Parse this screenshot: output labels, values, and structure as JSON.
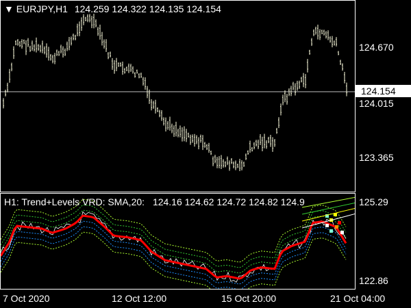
{
  "main": {
    "title_arrow": "▼",
    "title": "EURJPY,H1",
    "ohlc": "124.259 124.322 124.135 124.154",
    "current_price": "124.154",
    "y_labels": [
      "124.670",
      "124.015",
      "123.365"
    ]
  },
  "indicator": {
    "title": "H1: Trend+Levels VRD: SMA,20:",
    "values": "124.16 124.62 124.72 124.82 124.9",
    "y_labels": [
      "125.29",
      "122.86"
    ]
  },
  "x_labels": [
    "7 Oct 2020",
    "12 Oct 12:00",
    "15 Oct 20:00",
    "21 Oct 04:00"
  ],
  "colors": {
    "background": "#000000",
    "bars": "#ffffe0",
    "ma": "#ff0000",
    "band_upper": "#32cd32",
    "band_lower": "#1e90ff",
    "band_outer": "#adff2f",
    "price_line": "#c0c0c0"
  }
}
